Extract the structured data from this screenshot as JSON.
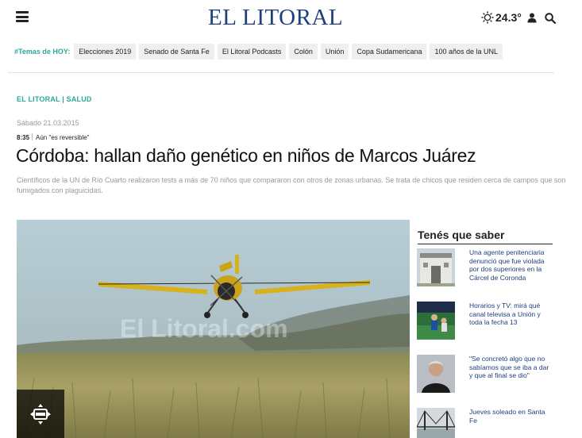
{
  "header": {
    "logo": "EL LITORAL",
    "menu_icon": "hamburger-menu-icon",
    "weather_icon": "sun-icon",
    "temperature": "24.3°",
    "user_icon": "user-icon",
    "search_icon": "search-icon"
  },
  "topics": {
    "label": "#Temas de HOY:",
    "items": [
      "Elecciones 2019",
      "Senado de Santa Fe",
      "El Litoral Podcasts",
      "Colón",
      "Unión",
      "Copa Sudamericana",
      "100 años de la UNL"
    ]
  },
  "article": {
    "section": "EL LITORAL | SALUD",
    "date": "Sábado 21.03.2015",
    "time": "8:35",
    "kicker": "Aún \"es reversible\"",
    "headline": "Córdoba: hallan daño genético en niños de Marcos Juárez",
    "summary": "Científicos de la UN de Río Cuarto realizaron tests a más de 70 niños que compararon con otros de zonas urbanas. Se trata de chicos que residen cerca de campos que son fumigados con plaguicidas.",
    "image_watermark": "El Litoral.com",
    "expand_icon": "expand-gallery-icon"
  },
  "sidebar": {
    "title": "Tenés que saber",
    "items": [
      {
        "text": "Una agente penitenciaria denunció que fue violada por dos superiores en la Cárcel de Coronda"
      },
      {
        "text": "Horarios y TV: mirá qué canal televisa a Unión y toda la fecha 13"
      },
      {
        "text": "\"Se concretó algo que no sabíamos que se iba a dar y que al final se dio\""
      },
      {
        "text": "Jueves soleado en Santa Fe"
      }
    ]
  },
  "colors": {
    "brand_blue": "#1f3f7f",
    "accent_teal": "#2aa89a"
  }
}
